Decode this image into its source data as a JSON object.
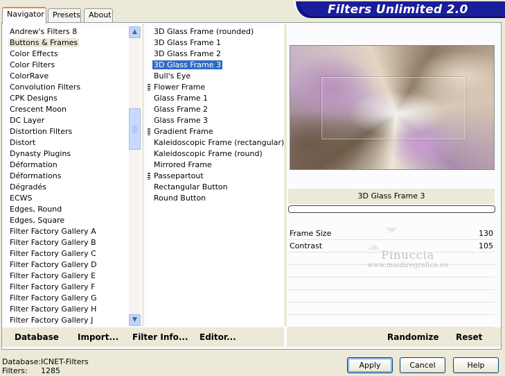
{
  "tabs": [
    {
      "label": "Navigator",
      "active": true
    },
    {
      "label": "Presets",
      "active": false
    },
    {
      "label": "About",
      "active": false
    }
  ],
  "banner_title": "Filters Unlimited 2.0",
  "categories": [
    "Andrew's Filters 8",
    "Buttons & Frames",
    "Color Effects",
    "Color Filters",
    "ColorRave",
    "Convolution Filters",
    "CPK Designs",
    "Crescent Moon",
    "DC Layer",
    "Distortion Filters",
    "Distort",
    "Dynasty Plugins",
    "Déformation",
    "Déformations",
    "Dégradés",
    "ECWS",
    "Edges, Round",
    "Edges, Square",
    "Filter Factory Gallery A",
    "Filter Factory Gallery B",
    "Filter Factory Gallery C",
    "Filter Factory Gallery D",
    "Filter Factory Gallery E",
    "Filter Factory Gallery F",
    "Filter Factory Gallery G",
    "Filter Factory Gallery H",
    "Filter Factory Gallery J"
  ],
  "selected_category": "Buttons & Frames",
  "filters": [
    {
      "label": "3D Glass Frame (rounded)",
      "marker": false
    },
    {
      "label": "3D Glass Frame 1",
      "marker": false
    },
    {
      "label": "3D Glass Frame 2",
      "marker": false
    },
    {
      "label": "3D Glass Frame 3",
      "marker": false
    },
    {
      "label": "Bull's Eye",
      "marker": false
    },
    {
      "label": "Flower Frame",
      "marker": true
    },
    {
      "label": "Glass Frame 1",
      "marker": false
    },
    {
      "label": "Glass Frame 2",
      "marker": false
    },
    {
      "label": "Glass Frame 3",
      "marker": false
    },
    {
      "label": "Gradient Frame",
      "marker": true
    },
    {
      "label": "Kaleidoscopic Frame (rectangular)",
      "marker": false
    },
    {
      "label": "Kaleidoscopic Frame (round)",
      "marker": false
    },
    {
      "label": "Mirrored Frame",
      "marker": false
    },
    {
      "label": "Passepartout",
      "marker": true
    },
    {
      "label": "Rectangular Button",
      "marker": false
    },
    {
      "label": "Round Button",
      "marker": false
    }
  ],
  "selected_filter": "3D Glass Frame 3",
  "preview": {
    "filter_name": "3D Glass Frame 3"
  },
  "params": [
    {
      "name": "Frame Size",
      "value": "130"
    },
    {
      "name": "Contrast",
      "value": "105"
    }
  ],
  "watermark": {
    "line1": "Pinuccia",
    "line2": "www.maidiregrafica.eu"
  },
  "left_buttons": {
    "database": "Database",
    "import": "Import...",
    "filter_info": "Filter Info...",
    "editor": "Editor..."
  },
  "right_buttons": {
    "randomize": "Randomize",
    "reset": "Reset"
  },
  "status": {
    "database_label": "Database:",
    "database_value": "ICNET-Filters",
    "filters_label": "Filters:",
    "filters_value": "1285"
  },
  "dialog_buttons": {
    "apply": "Apply",
    "cancel": "Cancel",
    "help": "Help"
  },
  "colors": {
    "selection_blue": "#316ac5",
    "banner_blue": "#10188c",
    "window_bg": "#ece9d8"
  }
}
